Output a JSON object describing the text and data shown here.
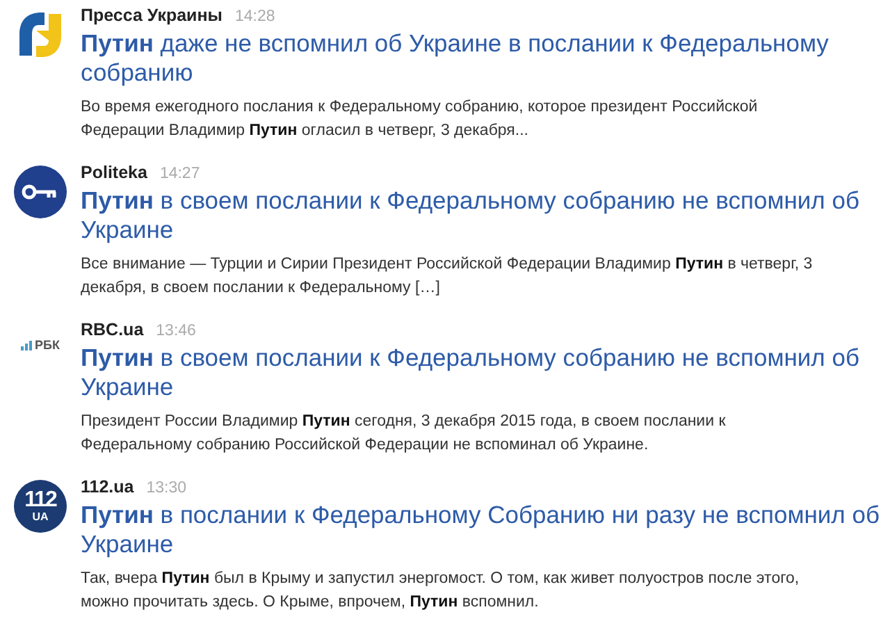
{
  "items": [
    {
      "logo": {
        "kind": "pu"
      },
      "source": "Пресса Украины",
      "time": "14:28",
      "headline": "**Путин** даже не вспомнил об Украине в послании к Федеральному собранию",
      "snippet": "Во время ежегодного послания к Федеральному собранию, которое президент Российской Федерации Владимир **Путин** огласил в четверг, 3 декабря..."
    },
    {
      "logo": {
        "kind": "key"
      },
      "source": "Politeka",
      "time": "14:27",
      "headline": "**Путин** в своем послании к Федеральному собранию не вспомнил об Украине",
      "snippet": "Все внимание — Турции и Сирии Президент Российской Федерации Владимир **Путин** в четверг, 3 декабря, в своем послании к Федеральному […]"
    },
    {
      "logo": {
        "kind": "rbk",
        "text": "РБК"
      },
      "source": "RBC.ua",
      "time": "13:46",
      "headline": "**Путин** в своем послании к Федеральному собранию не вспомнил об Украине",
      "snippet": "Президент России Владимир **Путин** сегодня, 3 декабря 2015 года, в своем послании к Федеральному собранию Российской Федерации не вспоминал об Украине."
    },
    {
      "logo": {
        "kind": "circle",
        "text": "112",
        "subtext": "UA"
      },
      "source": "112.ua",
      "time": "13:30",
      "headline": "**Путин** в послании к Федеральному Собранию ни разу не вспомнил об Украине",
      "snippet": "Так, вчера **Путин** был в Крыму и запустил энергомост. О том, как живет полуостров после этого, можно прочитать здесь. О Крыме, впрочем, **Путин** вспомнил."
    }
  ]
}
